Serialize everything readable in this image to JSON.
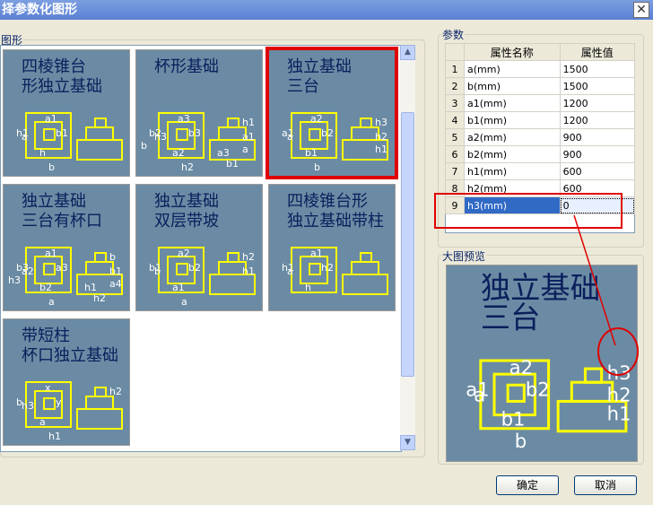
{
  "window": {
    "title": "择参数化图形",
    "close_icon": "close-icon"
  },
  "gallery": {
    "label": "图形",
    "items": [
      {
        "title": [
          "四棱锥台",
          "形独立基础"
        ],
        "labels": [
          "a1",
          "b1",
          "h1",
          "h",
          "a",
          "b"
        ]
      },
      {
        "title": [
          "杯形基础"
        ],
        "labels": [
          "a3",
          "b3",
          "b2",
          "a2",
          "h3",
          "h2",
          "h1",
          "a1",
          "a",
          "b",
          "b1",
          "a3"
        ]
      },
      {
        "title": [
          "独立基础",
          "三台"
        ],
        "labels": [
          "a2",
          "b2",
          "a1",
          "b1",
          "a",
          "b",
          "h3",
          "h2",
          "h1"
        ],
        "selected": true
      },
      {
        "title": [
          "独立基础",
          "三台有杯口"
        ],
        "labels": [
          "a1",
          "a3",
          "b3",
          "b2",
          "a2",
          "a",
          "b",
          "b1",
          "a4",
          "h3",
          "h2",
          "h1"
        ]
      },
      {
        "title": [
          "独立基础",
          "双层带坡"
        ],
        "labels": [
          "a2",
          "b2",
          "b1",
          "a1",
          "b",
          "a",
          "h2",
          "h1"
        ]
      },
      {
        "title": [
          "四棱锥台形",
          "独立基础带柱"
        ],
        "labels": [
          "a1",
          "h2",
          "h1",
          "h",
          "a"
        ]
      },
      {
        "title": [
          "带短柱",
          "杯口独立基础"
        ],
        "labels": [
          "x",
          "y",
          "b",
          "a",
          "h3",
          "h1",
          "h2"
        ]
      }
    ]
  },
  "params": {
    "label": "参数",
    "headers": [
      "属性名称",
      "属性值"
    ],
    "rows": [
      {
        "no": "1",
        "name": "a(mm)",
        "value": "1500"
      },
      {
        "no": "2",
        "name": "b(mm)",
        "value": "1500"
      },
      {
        "no": "3",
        "name": "a1(mm)",
        "value": "1200"
      },
      {
        "no": "4",
        "name": "b1(mm)",
        "value": "1200"
      },
      {
        "no": "5",
        "name": "a2(mm)",
        "value": "900"
      },
      {
        "no": "6",
        "name": "b2(mm)",
        "value": "900"
      },
      {
        "no": "7",
        "name": "h1(mm)",
        "value": "600"
      },
      {
        "no": "8",
        "name": "h2(mm)",
        "value": "600"
      },
      {
        "no": "9",
        "name": "h3(mm)",
        "value": "0"
      }
    ]
  },
  "preview": {
    "label": "大图预览",
    "title": [
      "独立基础",
      "三台"
    ],
    "labels": [
      "a2",
      "b2",
      "a1",
      "b1",
      "a",
      "b",
      "h3",
      "h2",
      "h1"
    ]
  },
  "buttons": {
    "ok": "确定",
    "cancel": "取消"
  },
  "colors": {
    "annotation": "#e00000",
    "diagram_bg": "#6b8ba4",
    "diagram_line": "#ffff00",
    "selection": "#316ac5"
  }
}
